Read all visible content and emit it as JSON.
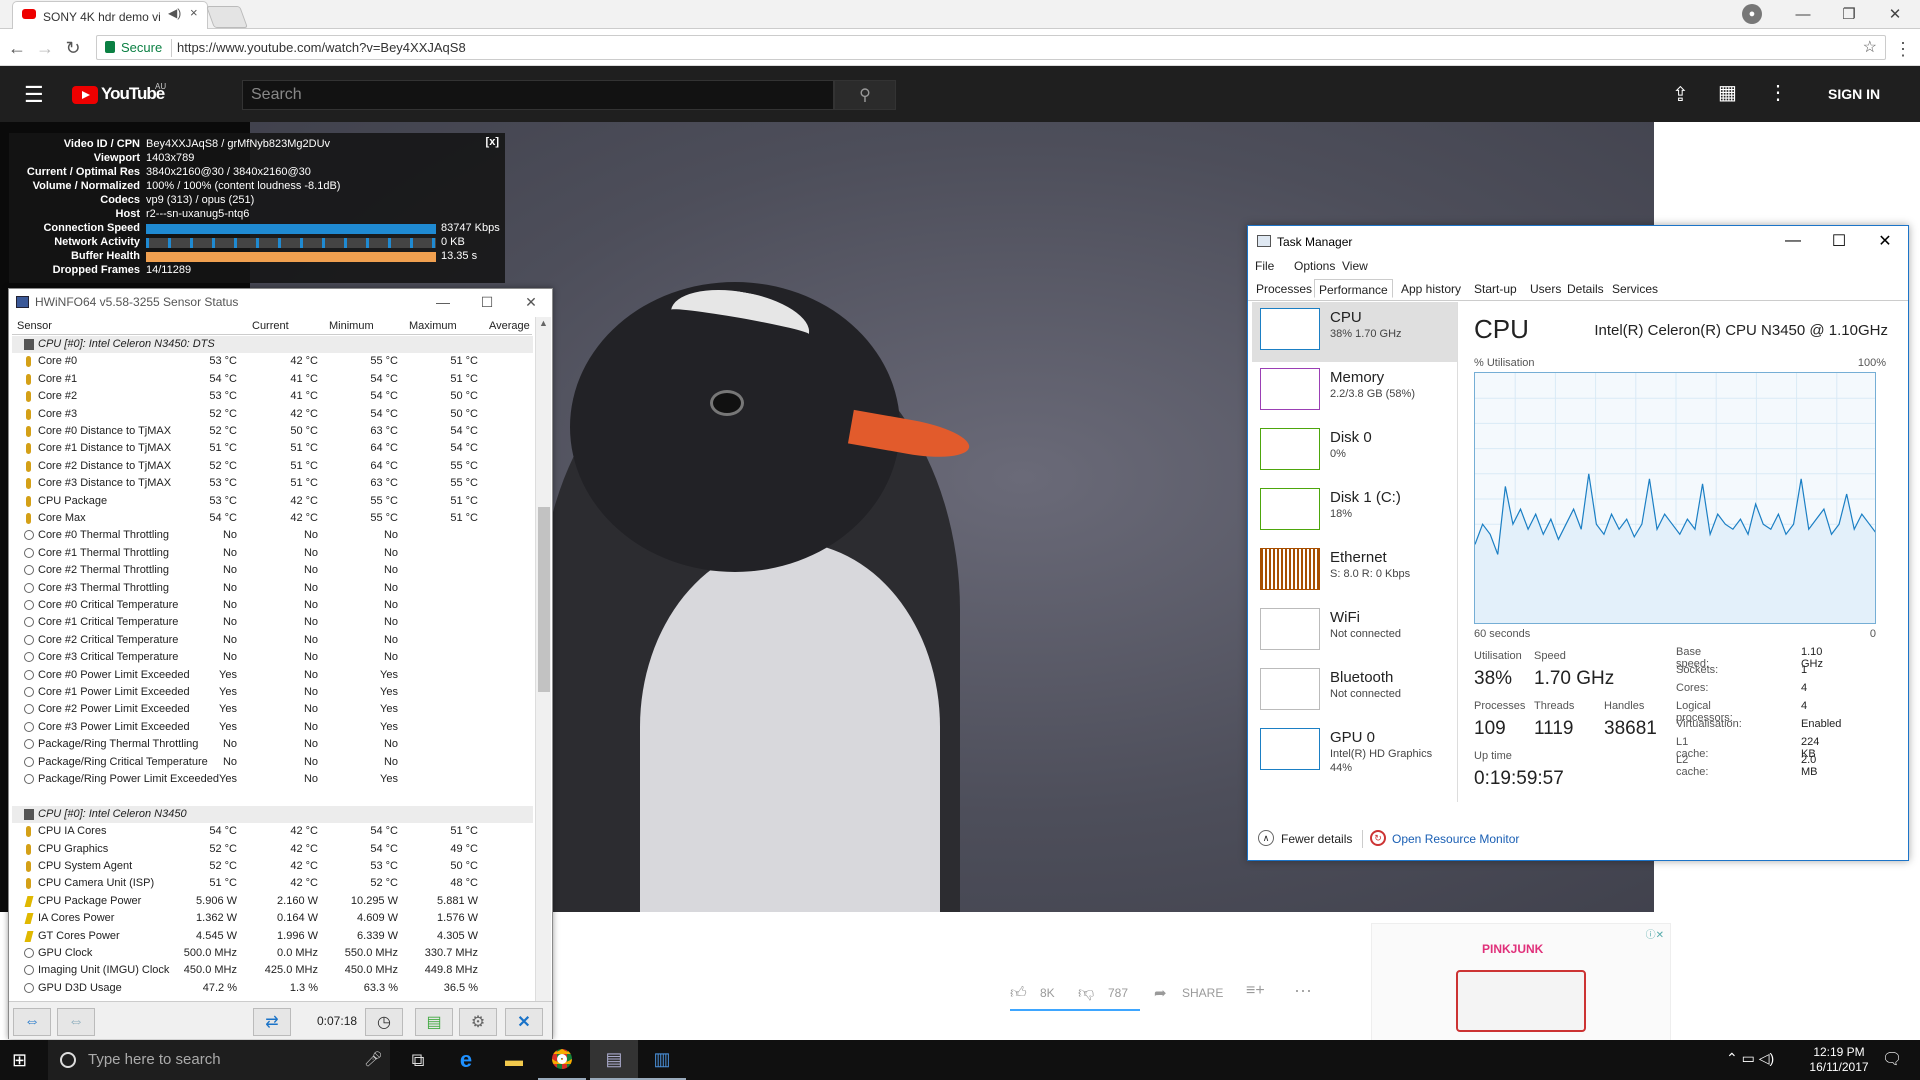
{
  "browser": {
    "tab_title": "SONY 4K hdr demo vi",
    "tab_close": "×",
    "secure_label": "Secure",
    "url": "https://www.youtube.com/watch?v=Bey4XXJAqS8"
  },
  "youtube": {
    "logo_text": "YouTube",
    "region": "AU",
    "search_placeholder": "Search",
    "sign_in": "SIGN IN",
    "likes": "8K",
    "dislikes": "787",
    "share": "SHARE"
  },
  "stats": {
    "close": "[x]",
    "rows": [
      {
        "label": "Video ID / CPN",
        "value": "Bey4XXJAqS8 / grMfNyb823Mg2DUv"
      },
      {
        "label": "Viewport",
        "value": "1403x789"
      },
      {
        "label": "Current / Optimal Res",
        "value": "3840x2160@30 / 3840x2160@30"
      },
      {
        "label": "Volume / Normalized",
        "value": "100% / 100% (content loudness -8.1dB)"
      },
      {
        "label": "Codecs",
        "value": "vp9 (313) / opus (251)"
      },
      {
        "label": "Host",
        "value": "r2---sn-uxanug5-ntq6"
      }
    ],
    "connection_label": "Connection Speed",
    "connection_value": "83747 Kbps",
    "network_label": "Network Activity",
    "network_value": "0 KB",
    "buffer_label": "Buffer Health",
    "buffer_value": "13.35 s",
    "dropped_label": "Dropped Frames",
    "dropped_value": "14/11289"
  },
  "hwinfo": {
    "title": "HWiNFO64 v5.58-3255 Sensor Status",
    "columns": [
      "Sensor",
      "Current",
      "Minimum",
      "Maximum",
      "Average"
    ],
    "elapsed": "0:07:18",
    "rows": [
      {
        "kind": "group",
        "name": "CPU [#0]: Intel Celeron N3450: DTS"
      },
      {
        "kind": "t",
        "name": "Core #0",
        "cur": "53 °C",
        "min": "42 °C",
        "max": "55 °C",
        "avg": "51 °C"
      },
      {
        "kind": "t",
        "name": "Core #1",
        "cur": "54 °C",
        "min": "41 °C",
        "max": "54 °C",
        "avg": "51 °C"
      },
      {
        "kind": "t",
        "name": "Core #2",
        "cur": "53 °C",
        "min": "41 °C",
        "max": "54 °C",
        "avg": "50 °C"
      },
      {
        "kind": "t",
        "name": "Core #3",
        "cur": "52 °C",
        "min": "42 °C",
        "max": "54 °C",
        "avg": "50 °C"
      },
      {
        "kind": "t",
        "name": "Core #0 Distance to TjMAX",
        "cur": "52 °C",
        "min": "50 °C",
        "max": "63 °C",
        "avg": "54 °C"
      },
      {
        "kind": "t",
        "name": "Core #1 Distance to TjMAX",
        "cur": "51 °C",
        "min": "51 °C",
        "max": "64 °C",
        "avg": "54 °C"
      },
      {
        "kind": "t",
        "name": "Core #2 Distance to TjMAX",
        "cur": "52 °C",
        "min": "51 °C",
        "max": "64 °C",
        "avg": "55 °C"
      },
      {
        "kind": "t",
        "name": "Core #3 Distance to TjMAX",
        "cur": "53 °C",
        "min": "51 °C",
        "max": "63 °C",
        "avg": "55 °C"
      },
      {
        "kind": "t",
        "name": "CPU Package",
        "cur": "53 °C",
        "min": "42 °C",
        "max": "55 °C",
        "avg": "51 °C"
      },
      {
        "kind": "t",
        "name": "Core Max",
        "cur": "54 °C",
        "min": "42 °C",
        "max": "55 °C",
        "avg": "51 °C"
      },
      {
        "kind": "c",
        "name": "Core #0 Thermal Throttling",
        "cur": "No",
        "min": "No",
        "max": "No",
        "avg": ""
      },
      {
        "kind": "c",
        "name": "Core #1 Thermal Throttling",
        "cur": "No",
        "min": "No",
        "max": "No",
        "avg": ""
      },
      {
        "kind": "c",
        "name": "Core #2 Thermal Throttling",
        "cur": "No",
        "min": "No",
        "max": "No",
        "avg": ""
      },
      {
        "kind": "c",
        "name": "Core #3 Thermal Throttling",
        "cur": "No",
        "min": "No",
        "max": "No",
        "avg": ""
      },
      {
        "kind": "c",
        "name": "Core #0 Critical Temperature",
        "cur": "No",
        "min": "No",
        "max": "No",
        "avg": ""
      },
      {
        "kind": "c",
        "name": "Core #1 Critical Temperature",
        "cur": "No",
        "min": "No",
        "max": "No",
        "avg": ""
      },
      {
        "kind": "c",
        "name": "Core #2 Critical Temperature",
        "cur": "No",
        "min": "No",
        "max": "No",
        "avg": ""
      },
      {
        "kind": "c",
        "name": "Core #3 Critical Temperature",
        "cur": "No",
        "min": "No",
        "max": "No",
        "avg": ""
      },
      {
        "kind": "c",
        "name": "Core #0 Power Limit Exceeded",
        "cur": "Yes",
        "min": "No",
        "max": "Yes",
        "avg": ""
      },
      {
        "kind": "c",
        "name": "Core #1 Power Limit Exceeded",
        "cur": "Yes",
        "min": "No",
        "max": "Yes",
        "avg": ""
      },
      {
        "kind": "c",
        "name": "Core #2 Power Limit Exceeded",
        "cur": "Yes",
        "min": "No",
        "max": "Yes",
        "avg": ""
      },
      {
        "kind": "c",
        "name": "Core #3 Power Limit Exceeded",
        "cur": "Yes",
        "min": "No",
        "max": "Yes",
        "avg": ""
      },
      {
        "kind": "c",
        "name": "Package/Ring Thermal Throttling",
        "cur": "No",
        "min": "No",
        "max": "No",
        "avg": ""
      },
      {
        "kind": "c",
        "name": "Package/Ring Critical Temperature",
        "cur": "No",
        "min": "No",
        "max": "No",
        "avg": ""
      },
      {
        "kind": "c",
        "name": "Package/Ring Power Limit Exceeded",
        "cur": "Yes",
        "min": "No",
        "max": "Yes",
        "avg": ""
      },
      {
        "kind": "blank"
      },
      {
        "kind": "group",
        "name": "CPU [#0]: Intel Celeron N3450"
      },
      {
        "kind": "t",
        "name": "CPU IA Cores",
        "cur": "54 °C",
        "min": "42 °C",
        "max": "54 °C",
        "avg": "51 °C"
      },
      {
        "kind": "t",
        "name": "CPU Graphics",
        "cur": "52 °C",
        "min": "42 °C",
        "max": "54 °C",
        "avg": "49 °C"
      },
      {
        "kind": "t",
        "name": "CPU System Agent",
        "cur": "52 °C",
        "min": "42 °C",
        "max": "53 °C",
        "avg": "50 °C"
      },
      {
        "kind": "t",
        "name": "CPU Camera Unit (ISP)",
        "cur": "51 °C",
        "min": "42 °C",
        "max": "52 °C",
        "avg": "48 °C"
      },
      {
        "kind": "p",
        "name": "CPU Package Power",
        "cur": "5.906 W",
        "min": "2.160 W",
        "max": "10.295 W",
        "avg": "5.881 W"
      },
      {
        "kind": "p",
        "name": "IA Cores Power",
        "cur": "1.362 W",
        "min": "0.164 W",
        "max": "4.609 W",
        "avg": "1.576 W"
      },
      {
        "kind": "p",
        "name": "GT Cores Power",
        "cur": "4.545 W",
        "min": "1.996 W",
        "max": "6.339 W",
        "avg": "4.305 W"
      },
      {
        "kind": "c",
        "name": "GPU Clock",
        "cur": "500.0 MHz",
        "min": "0.0 MHz",
        "max": "550.0 MHz",
        "avg": "330.7 MHz"
      },
      {
        "kind": "c",
        "name": "Imaging Unit (IMGU) Clock",
        "cur": "450.0 MHz",
        "min": "425.0 MHz",
        "max": "450.0 MHz",
        "avg": "449.8 MHz"
      },
      {
        "kind": "c",
        "name": "GPU D3D Usage",
        "cur": "47.2 %",
        "min": "1.3 %",
        "max": "63.3 %",
        "avg": "36.5 %"
      }
    ]
  },
  "taskmanager": {
    "title": "Task Manager",
    "menu": [
      "File",
      "Options",
      "View"
    ],
    "tabs": [
      "Processes",
      "Performance",
      "App history",
      "Start-up",
      "Users",
      "Details",
      "Services"
    ],
    "items": [
      {
        "name": "CPU",
        "sub": "38% 1.70 GHz",
        "color": "#1b7fc4"
      },
      {
        "name": "Memory",
        "sub": "2.2/3.8 GB (58%)",
        "color": "#9b3fb5"
      },
      {
        "name": "Disk 0",
        "sub": "0%",
        "color": "#4da60c"
      },
      {
        "name": "Disk 1 (C:)",
        "sub": "18%",
        "color": "#4da60c"
      },
      {
        "name": "Ethernet",
        "sub": "S: 8.0  R: 0 Kbps",
        "color": "#a74f01"
      },
      {
        "name": "WiFi",
        "sub": "Not connected",
        "color": "#bbbbbb"
      },
      {
        "name": "Bluetooth",
        "sub": "Not connected",
        "color": "#bbbbbb"
      },
      {
        "name": "GPU 0",
        "sub": "Intel(R) HD Graphics",
        "sub2": "44%",
        "color": "#1b7fc4"
      }
    ],
    "heading": "CPU",
    "model": "Intel(R) Celeron(R) CPU N3450 @ 1.10GHz",
    "util_label": "% Utilisation",
    "max_label": "100%",
    "window_label": "60 seconds",
    "zero_label": "0",
    "utilisation_label": "Utilisation",
    "utilisation": "38%",
    "speed_label": "Speed",
    "speed": "1.70 GHz",
    "processes_label": "Processes",
    "processes": "109",
    "threads_label": "Threads",
    "threads": "1119",
    "handles_label": "Handles",
    "handles": "38681",
    "uptime_label": "Up time",
    "uptime": "0:19:59:57",
    "specs": [
      {
        "k": "Base speed:",
        "v": "1.10 GHz"
      },
      {
        "k": "Sockets:",
        "v": "1"
      },
      {
        "k": "Cores:",
        "v": "4"
      },
      {
        "k": "Logical processors:",
        "v": "4"
      },
      {
        "k": "Virtualisation:",
        "v": "Enabled"
      },
      {
        "k": "L1 cache:",
        "v": "224 KB"
      },
      {
        "k": "L2 cache:",
        "v": "2.0 MB"
      }
    ],
    "fewer_details": "Fewer details",
    "open_monitor": "Open Resource Monitor",
    "graph_values": [
      32,
      40,
      36,
      28,
      55,
      40,
      46,
      38,
      44,
      36,
      42,
      34,
      40,
      46,
      38,
      60,
      40,
      36,
      44,
      38,
      42,
      35,
      40,
      58,
      38,
      44,
      40,
      36,
      42,
      38,
      56,
      36,
      44,
      40,
      38,
      42,
      36,
      48,
      40,
      38,
      44,
      36,
      40,
      58,
      38,
      42,
      46,
      36,
      40,
      52,
      38,
      44,
      40,
      36
    ]
  },
  "ad": {
    "brand": "PINKJUNK"
  },
  "taskbar": {
    "search_placeholder": "Type here to search",
    "time": "12:19 PM",
    "date": "16/11/2017"
  }
}
